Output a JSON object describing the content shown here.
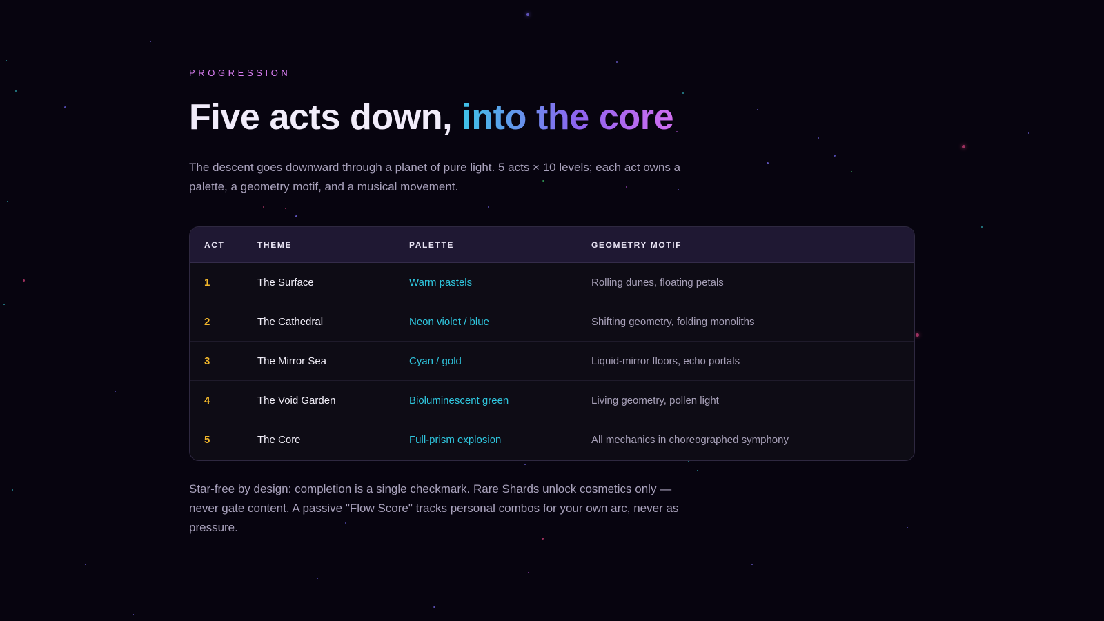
{
  "section": {
    "eyebrow": "PROGRESSION",
    "title_plain": "Five acts down, ",
    "title_highlight": "into the core",
    "lead": "The descent goes downward through a planet of pure light. 5 acts × 10 levels; each act owns a palette, a geometry motif, and a musical movement."
  },
  "table": {
    "headers": [
      "ACT",
      "THEME",
      "PALETTE",
      "GEOMETRY MOTIF"
    ],
    "rows": [
      {
        "act": "1",
        "theme": "The Surface",
        "palette": "Warm pastels",
        "motif": "Rolling dunes, floating petals"
      },
      {
        "act": "2",
        "theme": "The Cathedral",
        "palette": "Neon violet / blue",
        "motif": "Shifting geometry, folding monoliths"
      },
      {
        "act": "3",
        "theme": "The Mirror Sea",
        "palette": "Cyan / gold",
        "motif": "Liquid-mirror floors, echo portals"
      },
      {
        "act": "4",
        "theme": "The Void Garden",
        "palette": "Bioluminescent green",
        "motif": "Living geometry, pollen light"
      },
      {
        "act": "5",
        "theme": "The Core",
        "palette": "Full-prism explosion",
        "motif": "All mechanics in choreographed symphony"
      }
    ]
  },
  "footer": {
    "text": "Star-free by design: completion is a single checkmark. Rare Shards unlock cosmetics only — never gate content. A passive \"Flow Score\" tracks personal combos for your own arc, never as pressure."
  },
  "colors": {
    "background": "#07040f",
    "eyebrow": "#d97ef2",
    "act_number": "#f3b82b",
    "palette_text": "#2fc6de",
    "header_bg": "#1f1833",
    "gradient_start": "#3ec3e8",
    "gradient_end": "#d06ef0"
  }
}
